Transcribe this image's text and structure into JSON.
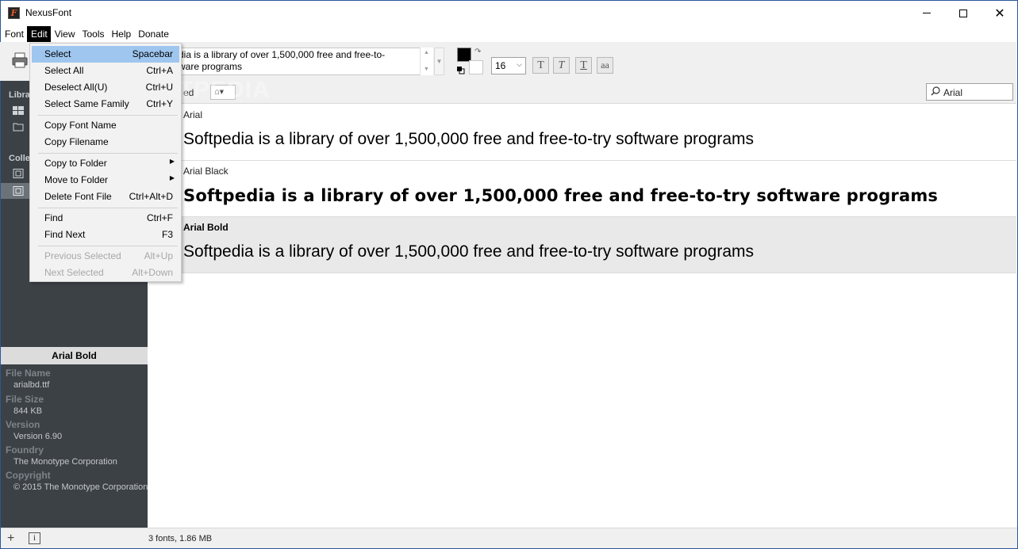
{
  "window": {
    "title": "NexusFont"
  },
  "menubar": {
    "items": [
      "Font",
      "Edit",
      "View",
      "Tools",
      "Help",
      "Donate"
    ]
  },
  "toolbar": {
    "preview_text": "Softpedia is a library of over 1,500,000 free and free-to-try software programs",
    "preview_line1": "dia is a library of over 1,500,000 free and free-to-",
    "preview_line2": "ware programs",
    "font_size": "16",
    "style_buttons": [
      "T",
      "T",
      "T",
      "aa"
    ],
    "foreground_color": "#000000",
    "background_color": "#ffffff"
  },
  "sidebar": {
    "library_label": "Libra",
    "collection_label": "Colle"
  },
  "filter": {
    "label": "ed",
    "search_value": "Arial"
  },
  "fonts": [
    {
      "name": "Arial",
      "sample": "Softpedia is a library of over 1,500,000 free and free-to-try software programs",
      "selected": false
    },
    {
      "name": "Arial Black",
      "sample": "Softpedia is a library of over 1,500,000 free and free-to-try software programs",
      "selected": false
    },
    {
      "name": "Arial Bold",
      "sample": "Softpedia is a library of over 1,500,000 free and free-to-try software programs",
      "selected": true
    }
  ],
  "info": {
    "title": "Arial Bold",
    "file_name_label": "File Name",
    "file_name": "arialbd.ttf",
    "file_size_label": "File Size",
    "file_size": "844 KB",
    "version_label": "Version",
    "version": "Version 6.90",
    "foundry_label": "Foundry",
    "foundry": "The Monotype Corporation",
    "copyright_label": "Copyright",
    "copyright": "© 2015 The Monotype Corporation"
  },
  "status": {
    "text": "3 fonts, 1.86 MB"
  },
  "edit_menu": {
    "select": {
      "label": "Select",
      "shortcut": "Spacebar"
    },
    "select_all": {
      "label": "Select All",
      "shortcut": "Ctrl+A"
    },
    "deselect_all": {
      "label": "Deselect All(U)",
      "shortcut": "Ctrl+U"
    },
    "select_same_family": {
      "label": "Select Same Family",
      "shortcut": "Ctrl+Y"
    },
    "copy_font_name": {
      "label": "Copy Font Name"
    },
    "copy_filename": {
      "label": "Copy Filename"
    },
    "copy_to_folder": {
      "label": "Copy to Folder"
    },
    "move_to_folder": {
      "label": "Move to Folder"
    },
    "delete_font_file": {
      "label": "Delete Font File",
      "shortcut": "Ctrl+Alt+D"
    },
    "find": {
      "label": "Find",
      "shortcut": "Ctrl+F"
    },
    "find_next": {
      "label": "Find Next",
      "shortcut": "F3"
    },
    "previous_selected": {
      "label": "Previous Selected",
      "shortcut": "Alt+Up"
    },
    "next_selected": {
      "label": "Next Selected",
      "shortcut": "Alt+Down"
    }
  },
  "watermark": "SOFTPEDIA",
  "colors": {
    "sidebar_bg": "#3c4146",
    "menu_highlight": "#9ec6ef",
    "selected_row": "#e9e9e9"
  }
}
